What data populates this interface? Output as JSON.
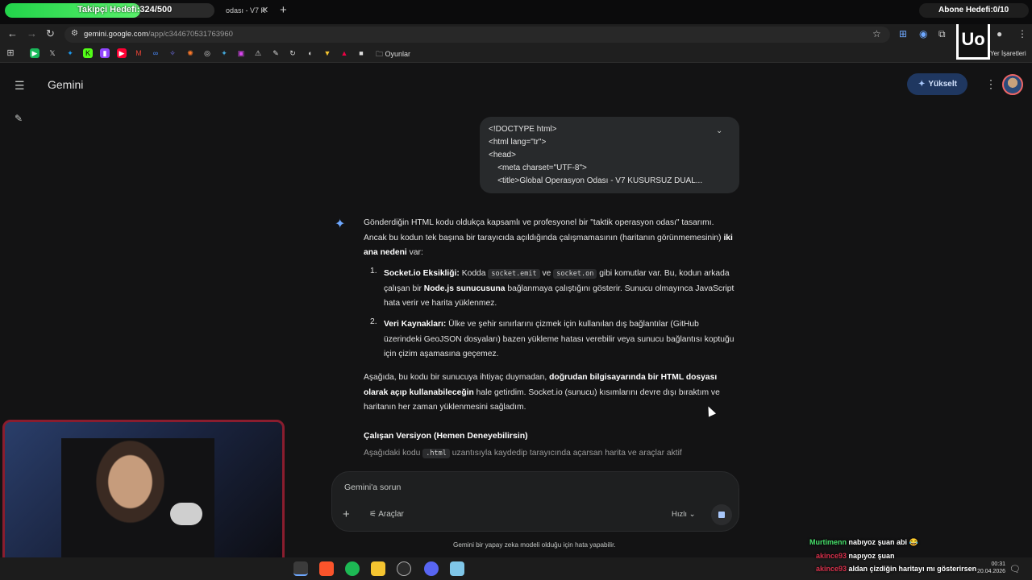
{
  "overlay": {
    "follower_goal": "Takipçi Hedefi:324/500",
    "follower_progress": 0.648,
    "subscriber_goal": "Abone Hedefi:0/10"
  },
  "browser": {
    "tab_title": "odası - V7 K",
    "url_host": "gemini.google.com",
    "url_path": "/app/c344670531763960",
    "bookmark_folder": "Oyunlar",
    "bookmarks_right": "Yer İşaretleri"
  },
  "app": {
    "brand": "Gemini",
    "upgrade_label": "Yükselt"
  },
  "user_message": "<!DOCTYPE html>\n<html lang=\"tr\">\n<head>\n    <meta charset=\"UTF-8\">\n    <title>Global Operasyon Odası - V7 KUSURSUZ DUAL...",
  "response": {
    "intro_a": "Gönderdiğin HTML kodu oldukça kapsamlı ve profesyonel bir \"taktik operasyon odası\" tasarımı. Ancak bu kodun tek başına bir tarayıcıda açıldığında çalışmamasının (haritanın görünmemesinin) ",
    "intro_b": "iki ana nedeni",
    "intro_c": " var:",
    "item1_num": "1.",
    "item1_title": "Socket.io Eksikliği:",
    "item1_a": " Kodda ",
    "item1_code1": "socket.emit",
    "item1_b": " ve ",
    "item1_code2": "socket.on",
    "item1_c": " gibi komutlar var. Bu, kodun arkada çalışan bir ",
    "item1_bold": "Node.js sunucusuna",
    "item1_d": " bağlanmaya çalıştığını gösterir. Sunucu olmayınca JavaScript hata verir ve harita yüklenmez.",
    "item2_num": "2.",
    "item2_title": "Veri Kaynakları:",
    "item2_text": " Ülke ve şehir sınırlarını çizmek için kullanılan dış bağlantılar (GitHub üzerindeki GeoJSON dosyaları) bazen yükleme hatası verebilir veya sunucu bağlantısı koptuğu için çizim aşamasına geçemez.",
    "para2_a": "Aşağıda, bu kodu bir sunucuya ihtiyaç duymadan, ",
    "para2_bold": "doğrudan bilgisayarında bir HTML dosyası olarak açıp kullanabileceğin",
    "para2_b": " hale getirdim. Socket.io (sunucu) kısımlarını devre dışı bıraktım ve haritanın her zaman yüklenmesini sağladım.",
    "heading": "Çalışan Versiyon (Hemen Deneyebilirsin)",
    "para3_a": "Aşağıdaki kodu ",
    "para3_code": ".html",
    "para3_b": " uzantısıyla kaydedip tarayıcında açarsan harita ve araçlar aktif"
  },
  "composer": {
    "placeholder": "Gemini'a sorun",
    "tools_label": "Araçlar",
    "mode_label": "Hızlı",
    "disclaimer": "Gemini bir yapay zeka modeli olduğu için hata yapabilir."
  },
  "chat": [
    {
      "user": "Murtimenn",
      "message": "nabıyoz şuan abi 😂"
    },
    {
      "user": "akince93",
      "message": "napıyoz şuan"
    },
    {
      "user": "akince93",
      "message": "aldan çizdiğin haritayı mı gösterirsen"
    }
  ],
  "clock": {
    "time": "00:31",
    "date": "20.04.2026"
  },
  "colors": {
    "accent": "#1f3760",
    "follower_bar": "#22d34a",
    "cam_border": "#8a1d2e"
  }
}
